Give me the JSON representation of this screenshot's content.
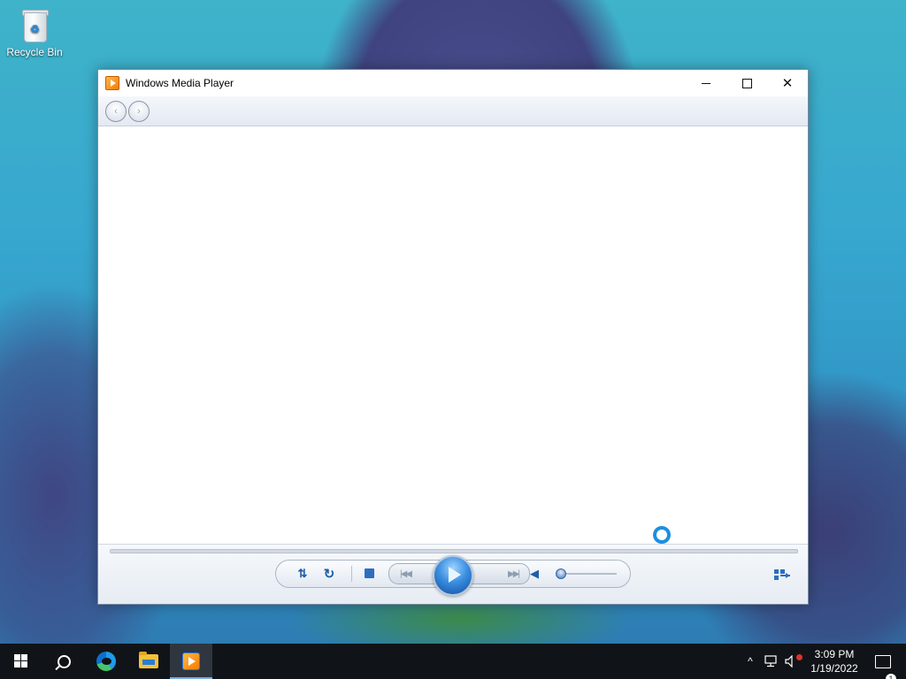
{
  "desktop": {
    "icons": [
      {
        "label": "Recycle Bin",
        "icon": "recycle-bin-icon"
      }
    ]
  },
  "window": {
    "title": "Windows Media Player",
    "app_icon": "windows-media-player-icon",
    "controls": {
      "minimize": "minimize",
      "maximize": "maximize",
      "close": "✕"
    }
  },
  "navbar": {
    "back": "‹",
    "forward": "›"
  },
  "player": {
    "shuffle_glyph": "⇅",
    "repeat_glyph": "↻",
    "prev_glyph": "|◀◀",
    "next_glyph": "▶▶|",
    "mute_glyph": "◀",
    "volume_level": 0.05,
    "seek_progress": 0
  },
  "taskbar": {
    "apps": [
      {
        "name": "start",
        "icon": "windows-logo-icon"
      },
      {
        "name": "search",
        "icon": "search-icon"
      },
      {
        "name": "edge",
        "icon": "edge-browser-icon"
      },
      {
        "name": "file-explorer",
        "icon": "folder-icon"
      },
      {
        "name": "windows-media-player",
        "icon": "windows-media-player-icon",
        "active": true
      }
    ],
    "tray": {
      "chevron": "^",
      "time": "3:09 PM",
      "date": "1/19/2022",
      "notification_count": "1"
    }
  },
  "colors": {
    "accent": "#2c6fc0",
    "taskbar": "#101418",
    "active_indicator": "#78aee6"
  }
}
